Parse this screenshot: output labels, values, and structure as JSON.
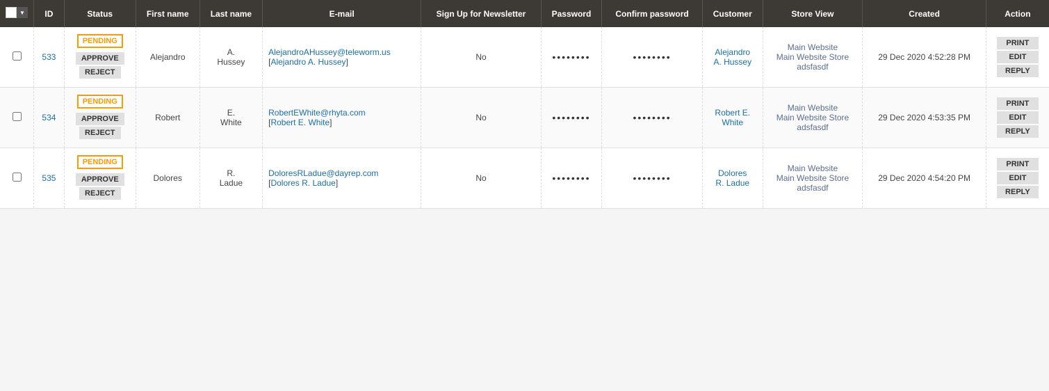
{
  "colors": {
    "header_bg": "#3d3935",
    "header_text": "#ffffff",
    "pending_border": "#ff9900",
    "pending_text": "#ff9900",
    "id_link": "#1a6fa8",
    "customer_link": "#1a6fa8"
  },
  "table": {
    "columns": [
      {
        "key": "checkbox",
        "label": ""
      },
      {
        "key": "id",
        "label": "ID"
      },
      {
        "key": "status",
        "label": "Status"
      },
      {
        "key": "first_name",
        "label": "First name"
      },
      {
        "key": "last_name",
        "label": "Last name"
      },
      {
        "key": "email",
        "label": "E-mail"
      },
      {
        "key": "newsletter",
        "label": "Sign Up for Newsletter"
      },
      {
        "key": "password",
        "label": "Password"
      },
      {
        "key": "confirm_password",
        "label": "Confirm password"
      },
      {
        "key": "customer",
        "label": "Customer"
      },
      {
        "key": "store_view",
        "label": "Store View"
      },
      {
        "key": "created",
        "label": "Created"
      },
      {
        "key": "action",
        "label": "Action"
      }
    ],
    "rows": [
      {
        "id": "533",
        "status": "PENDING",
        "first_name": "Alejandro",
        "last_name_line1": "A.",
        "last_name_line2": "Hussey",
        "email": "AlejandroAHussey@teleworm.us",
        "email_link_text": "Alejandro A. Hussey",
        "newsletter": "No",
        "password": "••••••••",
        "confirm_password": "••••••••",
        "customer_line1": "Alejandro",
        "customer_line2": "A. Hussey",
        "store_view": "Main Website Main Website Store adsfasdf",
        "created": "29 Dec 2020 4:52:28 PM",
        "btn_approve": "APPROVE",
        "btn_reject": "REJECT",
        "btn_print": "PRINT",
        "btn_edit": "EDIT",
        "btn_reply": "REPLY"
      },
      {
        "id": "534",
        "status": "PENDING",
        "first_name": "Robert",
        "last_name_line1": "E.",
        "last_name_line2": "White",
        "email": "RobertEWhite@rhyta.com",
        "email_link_text": "Robert E. White",
        "newsletter": "No",
        "password": "••••••••",
        "confirm_password": "••••••••",
        "customer_line1": "Robert E.",
        "customer_line2": "White",
        "store_view": "Main Website Main Website Store adsfasdf",
        "created": "29 Dec 2020 4:53:35 PM",
        "btn_approve": "APPROVE",
        "btn_reject": "REJECT",
        "btn_print": "PRINT",
        "btn_edit": "EDIT",
        "btn_reply": "REPLY"
      },
      {
        "id": "535",
        "status": "PENDING",
        "first_name": "Dolores",
        "last_name_line1": "R.",
        "last_name_line2": "Ladue",
        "email": "DoloresRLadue@dayrep.com",
        "email_link_text": "Dolores R. Ladue",
        "newsletter": "No",
        "password": "••••••••",
        "confirm_password": "••••••••",
        "customer_line1": "Dolores",
        "customer_line2": "R. Ladue",
        "store_view": "Main Website Main Website Store adsfasdf",
        "created": "29 Dec 2020 4:54:20 PM",
        "btn_approve": "APPROVE",
        "btn_reject": "REJECT",
        "btn_print": "PRINT",
        "btn_edit": "EDIT",
        "btn_reply": "REPLY"
      }
    ]
  }
}
